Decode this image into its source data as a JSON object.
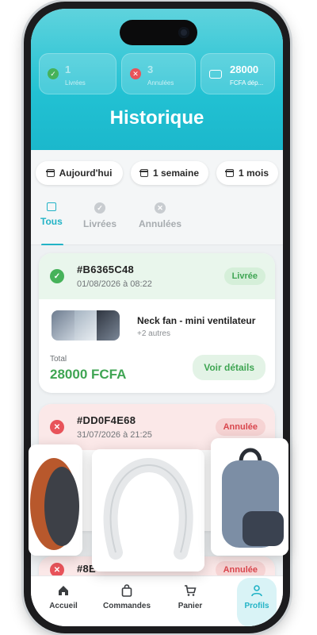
{
  "stats": [
    {
      "value": "1",
      "label": "Livrées",
      "icon": "check-circle-icon",
      "color": "#46b25a"
    },
    {
      "value": "3",
      "label": "Annulées",
      "icon": "cancel-circle-icon",
      "color": "#e8535a"
    },
    {
      "value": "28000",
      "label": "FCFA dép...",
      "icon": "cash-icon",
      "color": "#ffffff"
    }
  ],
  "page_title": "Historique",
  "filters": [
    "Aujourd'hui",
    "1 semaine",
    "1 mois"
  ],
  "tabs": [
    {
      "label": "Tous",
      "icon": "inbox-icon"
    },
    {
      "label": "Livrées",
      "icon": "check-circle-icon"
    },
    {
      "label": "Annulées",
      "icon": "cancel-circle-icon"
    }
  ],
  "orders": [
    {
      "id": "#B6365C48",
      "date": "01/08/2026 à 08:22",
      "status": "Livrée",
      "product": "Neck fan - mini ventilateur",
      "more": "+2 autres",
      "total_label": "Total",
      "total": "28000 FCFA",
      "details_label": "Voir détails"
    },
    {
      "id": "#DD0F4E68",
      "date": "31/07/2026 à 21:25",
      "status": "Annulée"
    },
    {
      "id": "#8E",
      "status": "Annulée"
    }
  ],
  "nav": [
    {
      "label": "Accueil",
      "icon": "home-icon"
    },
    {
      "label": "Commandes",
      "icon": "bag-icon"
    },
    {
      "label": "Panier",
      "icon": "cart-icon"
    },
    {
      "label": "Profils",
      "icon": "user-icon"
    }
  ],
  "colors": {
    "accent": "#22b3c6",
    "success": "#3fa553",
    "danger": "#d9464d"
  }
}
